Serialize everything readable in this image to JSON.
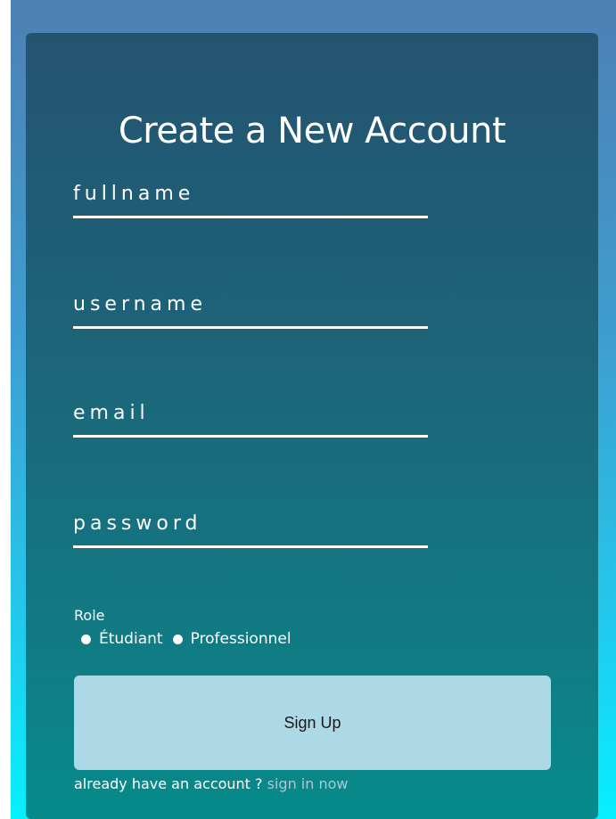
{
  "title": "Create a New Account",
  "form": {
    "fields": [
      {
        "name": "fullname",
        "placeholder": "fullname",
        "value": ""
      },
      {
        "name": "username",
        "placeholder": "username",
        "value": ""
      },
      {
        "name": "email",
        "placeholder": "email",
        "value": ""
      },
      {
        "name": "password",
        "placeholder": "password",
        "value": ""
      }
    ],
    "role": {
      "label": "Role",
      "options": [
        "Étudiant",
        "Professionnel"
      ]
    },
    "submit_label": "Sign Up"
  },
  "footer": {
    "text": "already have an account ?",
    "link_text": "sign in now"
  },
  "colors": {
    "button_bg": "#add8e6",
    "card_top": "#245370",
    "card_bottom": "#078b8a",
    "link": "#a9c9d6"
  }
}
